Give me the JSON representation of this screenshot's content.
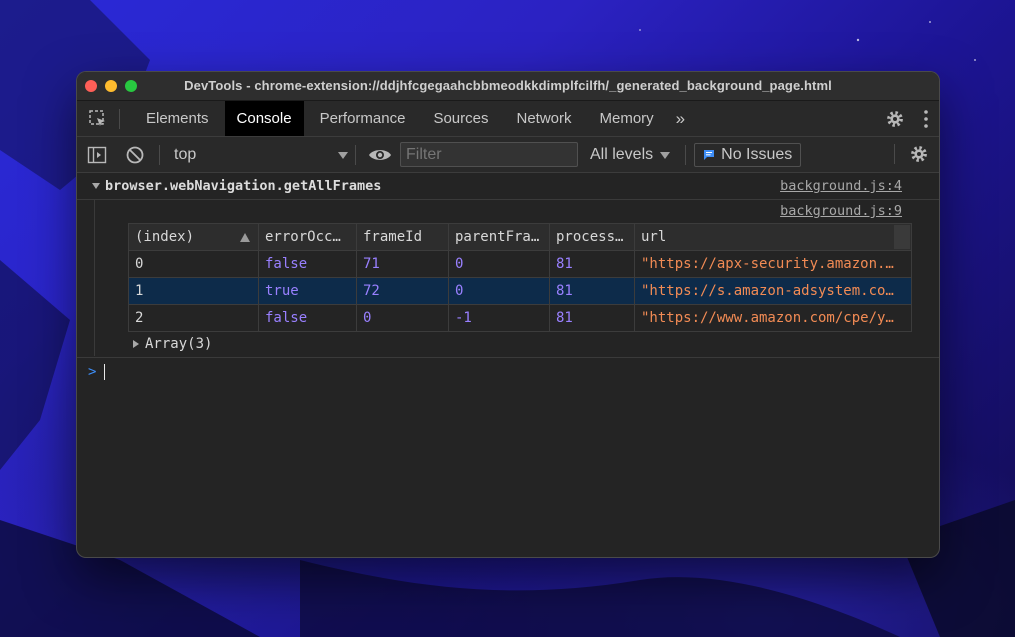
{
  "window": {
    "title": "DevTools - chrome-extension://ddjhfcgegaahcbbmeodkkdimplfcilfh/_generated_background_page.html"
  },
  "tabs": [
    {
      "label": "Elements",
      "active": false
    },
    {
      "label": "Console",
      "active": true
    },
    {
      "label": "Performance",
      "active": false
    },
    {
      "label": "Sources",
      "active": false
    },
    {
      "label": "Network",
      "active": false
    },
    {
      "label": "Memory",
      "active": false
    }
  ],
  "more_tabs_label": "»",
  "toolbar": {
    "context": "top",
    "filter_placeholder": "Filter",
    "levels": "All levels",
    "issues": "No Issues"
  },
  "console": {
    "group_label": "browser.webNavigation.getAllFrames",
    "group_source": "background.js:4",
    "table_source": "background.js:9",
    "table": {
      "headers": [
        "(index)",
        "errorOcc…",
        "frameId",
        "parentFra…",
        "process…",
        "url"
      ],
      "rows": [
        {
          "index": "0",
          "errorOccurred": "false",
          "frameId": "71",
          "parentFrameId": "0",
          "processId": "81",
          "url": "\"https://apx-security.amazon.…"
        },
        {
          "index": "1",
          "errorOccurred": "true",
          "frameId": "72",
          "parentFrameId": "0",
          "processId": "81",
          "url": "\"https://s.amazon-adsystem.co…"
        },
        {
          "index": "2",
          "errorOccurred": "false",
          "frameId": "0",
          "parentFrameId": "-1",
          "processId": "81",
          "url": "\"https://www.amazon.com/cpe/y…"
        }
      ]
    },
    "array_label": "Array(3)",
    "prompt_symbol": ">"
  },
  "colors": {
    "keyword": "#9980ff",
    "string": "#f28b54",
    "selected_row": "#0d2b4a",
    "prompt": "#3e8ef7"
  },
  "icons": [
    "inspect-icon",
    "gear-icon",
    "kebab-menu-icon",
    "sidebar-toggle-icon",
    "clear-console-icon",
    "eye-icon",
    "chevron-down-icon",
    "issue-message-icon",
    "sort-ascending-icon",
    "triangle-expand-icon",
    "triangle-collapse-icon"
  ]
}
